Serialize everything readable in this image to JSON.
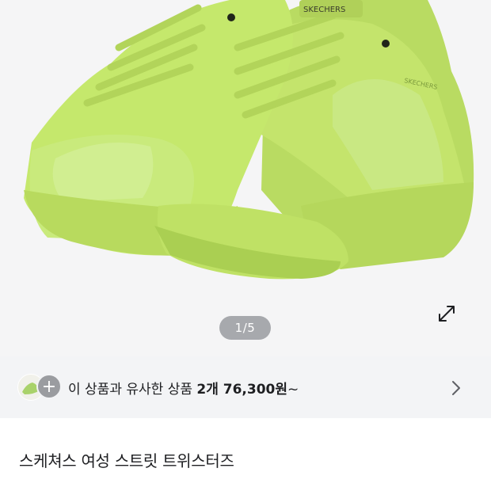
{
  "gallery": {
    "indicator": "1/5",
    "product_color": "#c5e86c",
    "brand_print": "SKECHERS"
  },
  "similar": {
    "prefix": "이 상품과 유사한 상품 ",
    "count_price": "2개 76,300원",
    "suffix": "~"
  },
  "product": {
    "title": "스케쳐스 여성 스트릿 트위스터즈"
  },
  "icons": [
    "expand-icon",
    "plus-icon",
    "chevron-right-icon"
  ]
}
